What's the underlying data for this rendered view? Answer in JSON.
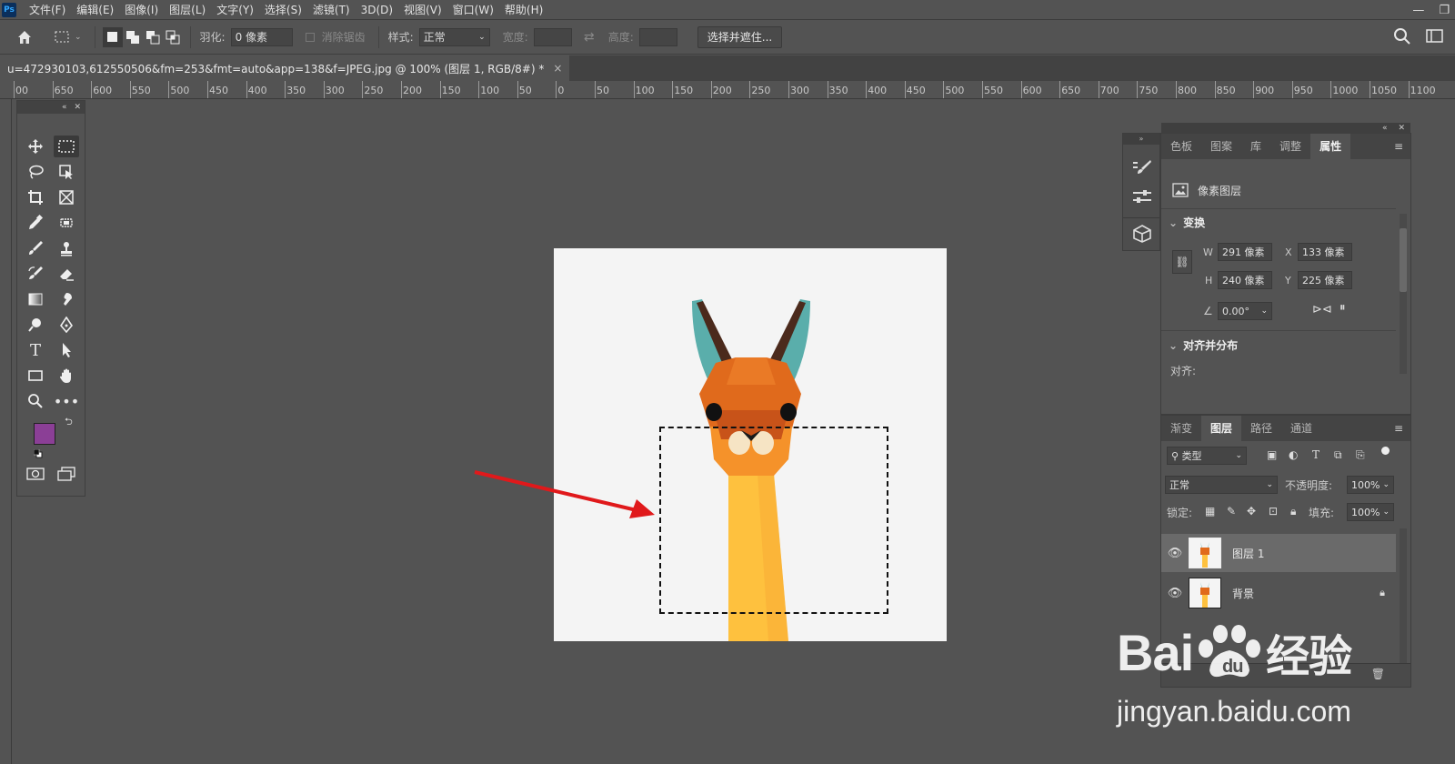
{
  "app": {
    "logo": "Ps"
  },
  "menu": [
    "文件(F)",
    "编辑(E)",
    "图像(I)",
    "图层(L)",
    "文字(Y)",
    "选择(S)",
    "滤镜(T)",
    "3D(D)",
    "视图(V)",
    "窗口(W)",
    "帮助(H)"
  ],
  "options": {
    "feather_label": "羽化:",
    "feather_value": "0 像素",
    "antialias_label": "消除锯齿",
    "style_label": "样式:",
    "style_value": "正常",
    "width_label": "宽度:",
    "height_label": "高度:",
    "select_mask_button": "选择并遮住..."
  },
  "document": {
    "tab_title": "u=472930103,612550506&fm=253&fmt=auto&app=138&f=JPEG.jpg @ 100% (图层 1, RGB/8#) *",
    "close": "×"
  },
  "ruler": {
    "labels": [
      "00",
      "650",
      "600",
      "550",
      "500",
      "450",
      "400",
      "350",
      "300",
      "250",
      "200",
      "150",
      "100",
      "50",
      "0",
      "50",
      "100",
      "150",
      "200",
      "250",
      "300",
      "350",
      "400",
      "450",
      "500",
      "550",
      "600",
      "650",
      "700",
      "750",
      "800",
      "850",
      "900",
      "950",
      "1000",
      "1050",
      "1100"
    ]
  },
  "colors": {
    "foreground": "#8b3f96",
    "background": "#ffffff",
    "arrow": "#e0191b",
    "llama_ear": "#5aaeab",
    "llama_head": "#e06a1c",
    "llama_neck": "#fec13e"
  },
  "properties": {
    "tabs": [
      "色板",
      "图案",
      "库",
      "调整",
      "属性"
    ],
    "active_tab": "属性",
    "layer_type": "像素图层",
    "transform_title": "变换",
    "w_label": "W",
    "w_value": "291 像素",
    "h_label": "H",
    "h_value": "240 像素",
    "x_label": "X",
    "x_value": "133 像素",
    "y_label": "Y",
    "y_value": "225 像素",
    "angle_value": "0.00°",
    "align_title": "对齐并分布",
    "align_label": "对齐:"
  },
  "layers": {
    "tabs": [
      "渐变",
      "图层",
      "路径",
      "通道"
    ],
    "active_tab": "图层",
    "filter_kind": "类型",
    "blend_mode": "正常",
    "opacity_label": "不透明度:",
    "opacity_value": "100%",
    "lock_label": "锁定:",
    "fill_label": "填充:",
    "fill_value": "100%",
    "items": [
      {
        "name": "图层 1",
        "selected": true
      },
      {
        "name": "背景",
        "locked": true
      }
    ]
  },
  "watermark": {
    "brand": "Bai",
    "brand2": "经验",
    "url": "jingyan.baidu.com"
  }
}
